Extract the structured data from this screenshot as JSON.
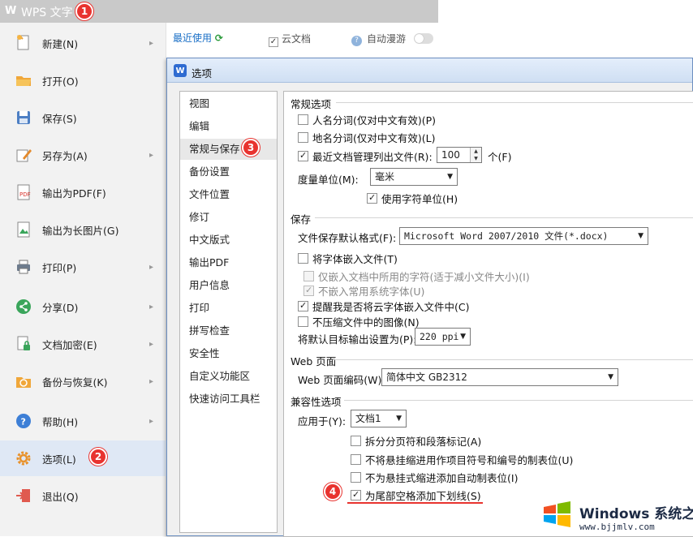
{
  "app": {
    "logo": "W",
    "title": "WPS 文字"
  },
  "markers": {
    "m1": "1",
    "m2": "2",
    "m3": "3",
    "m4": "4"
  },
  "menu": {
    "items": [
      {
        "label": "新建(N)",
        "icon": "new-document-icon",
        "arrow": "▸"
      },
      {
        "label": "打开(O)",
        "icon": "folder-open-icon",
        "arrow": ""
      },
      {
        "label": "保存(S)",
        "icon": "save-icon",
        "arrow": ""
      },
      {
        "label": "另存为(A)",
        "icon": "save-as-icon",
        "arrow": "▸"
      },
      {
        "label": "输出为PDF(F)",
        "icon": "pdf-icon",
        "arrow": ""
      },
      {
        "label": "输出为长图片(G)",
        "icon": "image-export-icon",
        "arrow": ""
      },
      {
        "label": "打印(P)",
        "icon": "printer-icon",
        "arrow": "▸"
      },
      {
        "label": "分享(D)",
        "icon": "share-icon",
        "arrow": "▸"
      },
      {
        "label": "文档加密(E)",
        "icon": "lock-document-icon",
        "arrow": "▸"
      },
      {
        "label": "备份与恢复(K)",
        "icon": "backup-icon",
        "arrow": "▸"
      },
      {
        "label": "帮助(H)",
        "icon": "help-icon",
        "arrow": "▸"
      },
      {
        "label": "选项(L)",
        "icon": "gear-icon",
        "arrow": ""
      },
      {
        "label": "退出(Q)",
        "icon": "exit-icon",
        "arrow": ""
      }
    ]
  },
  "toolbar": {
    "recent": "最近使用",
    "cloud": "云文档",
    "roam": "自动漫游"
  },
  "dialog": {
    "title": "选项",
    "nav": [
      "视图",
      "编辑",
      "常规与保存",
      "备份设置",
      "文件位置",
      "修订",
      "中文版式",
      "输出PDF",
      "用户信息",
      "打印",
      "拼写检查",
      "安全性",
      "自定义功能区",
      "快速访问工具栏"
    ],
    "general": {
      "heading": "常规选项",
      "person_names": "人名分词(仅对中文有效)(P)",
      "place_names": "地名分词(仅对中文有效)(L)",
      "recent_list": "最近文档管理列出文件(R):",
      "recent_value": "100",
      "recent_unit": "个(F)",
      "unit_label": "度量单位(M):",
      "unit_value": "毫米",
      "char_unit": "使用字符单位(H)"
    },
    "save": {
      "heading": "保存",
      "format_label": "文件保存默认格式(F):",
      "format_value": "Microsoft Word 2007/2010 文件(*.docx)",
      "embed_fonts": "将字体嵌入文件(T)",
      "embed_used_only": "仅嵌入文档中所用的字符(适于减小文件大小)(I)",
      "no_common_fonts": "不嵌入常用系统字体(U)",
      "remind_cloud": "提醒我是否将云字体嵌入文件中(C)",
      "no_compress": "不压缩文件中的图像(N)",
      "ppi_label": "将默认目标输出设置为(P):",
      "ppi_value": "220 ppi"
    },
    "web": {
      "heading": "Web 页面",
      "encoding_label": "Web 页面编码(W):",
      "encoding_value": "简体中文 GB2312"
    },
    "compat": {
      "heading": "兼容性选项",
      "apply_label": "应用于(Y):",
      "apply_value": "文档1",
      "opt1": "拆分分页符和段落标记(A)",
      "opt2": "不将悬挂缩进用作项目符号和编号的制表位(U)",
      "opt3": "不为悬挂式缩进添加自动制表位(I)",
      "opt4": "为尾部空格添加下划线(S)"
    }
  },
  "watermark": {
    "brand": "Windows 系统之家",
    "url": "www.bjjmlv.com"
  }
}
